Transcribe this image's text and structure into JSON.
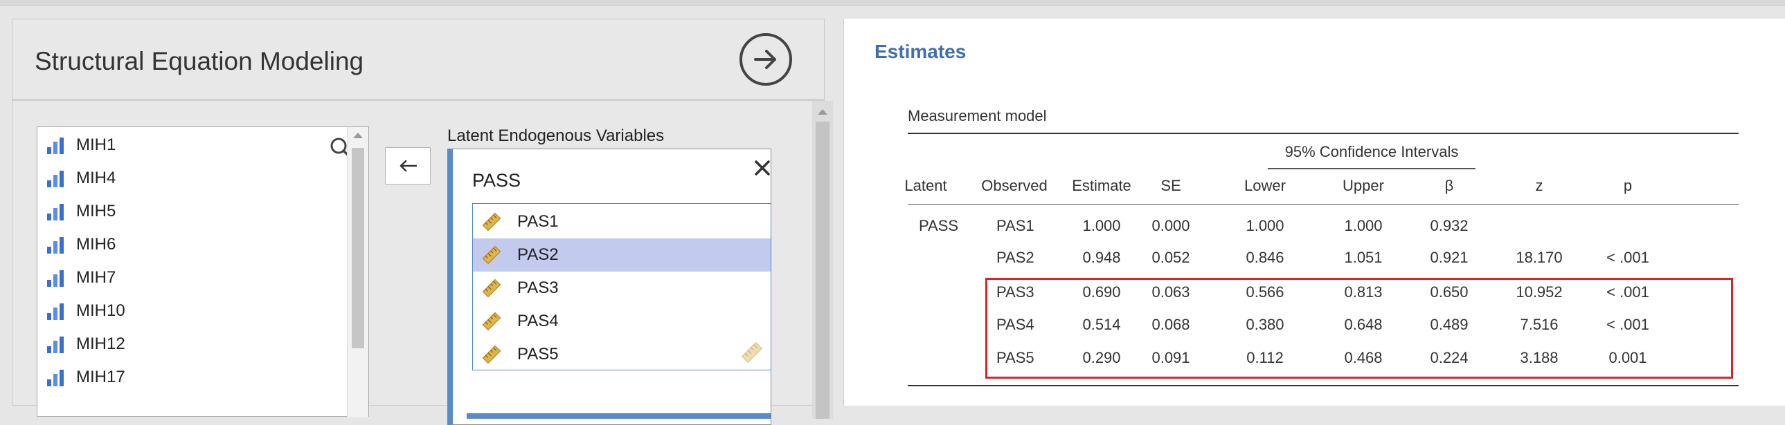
{
  "left_panel": {
    "title": "Structural Equation Modeling",
    "variables": [
      "MIH1",
      "MIH4",
      "MIH5",
      "MIH6",
      "MIH7",
      "MIH10",
      "MIH12",
      "MIH17"
    ],
    "latent_section_label": "Latent Endogenous Variables",
    "latent": {
      "name": "PASS",
      "indicators": [
        "PAS1",
        "PAS2",
        "PAS3",
        "PAS4",
        "PAS5"
      ],
      "selected_indicator": "PAS2"
    }
  },
  "results": {
    "title": "Estimates",
    "table_title": "Measurement model",
    "ci_header": "95% Confidence Intervals",
    "columns": [
      "Latent",
      "Observed",
      "Estimate",
      "SE",
      "Lower",
      "Upper",
      "β",
      "z",
      "p"
    ],
    "rows": [
      [
        "PASS",
        "PAS1",
        "1.000",
        "0.000",
        "1.000",
        "1.000",
        "0.932",
        "",
        ""
      ],
      [
        "",
        "PAS2",
        "0.948",
        "0.052",
        "0.846",
        "1.051",
        "0.921",
        "18.170",
        "< .001"
      ],
      [
        "",
        "PAS3",
        "0.690",
        "0.063",
        "0.566",
        "0.813",
        "0.650",
        "10.952",
        "< .001"
      ],
      [
        "",
        "PAS4",
        "0.514",
        "0.068",
        "0.380",
        "0.648",
        "0.489",
        "7.516",
        "< .001"
      ],
      [
        "",
        "PAS5",
        "0.290",
        "0.091",
        "0.112",
        "0.468",
        "0.224",
        "3.188",
        "0.001"
      ]
    ]
  },
  "colors": {
    "accent": "#3e6eae",
    "selection": "#c2cbee",
    "latent_border": "#5b8ac9",
    "highlight": "#d8252b"
  },
  "icons": {
    "run": "arrow-right-circle-icon",
    "search": "search-icon",
    "move": "arrow-left-icon",
    "remove": "close-icon",
    "variable": "nominal-bar-icon",
    "indicator": "ruler-icon"
  }
}
